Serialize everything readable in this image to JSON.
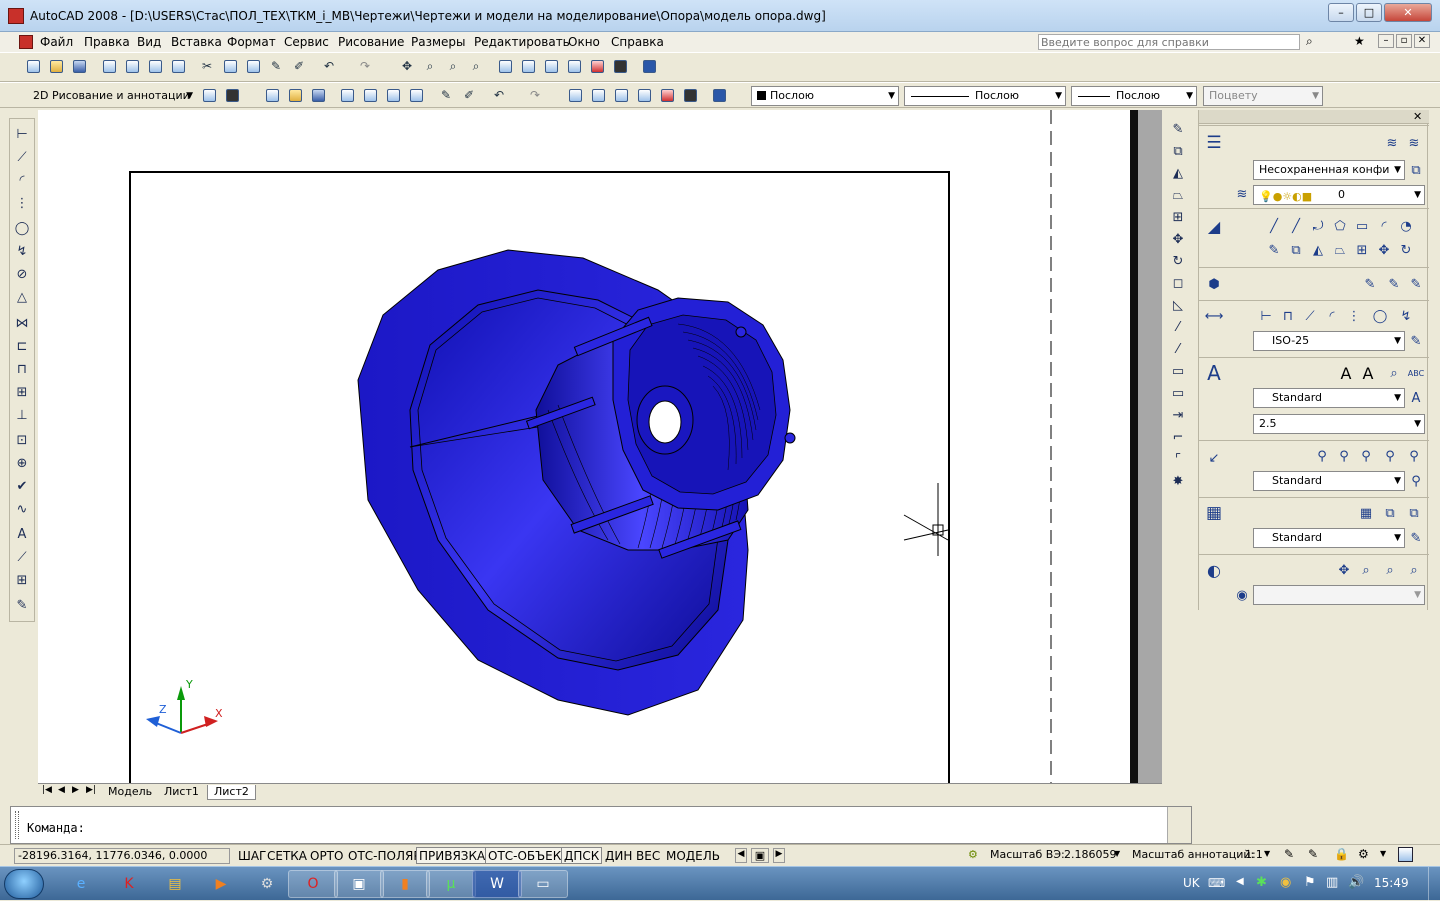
{
  "window": {
    "title": "AutoCAD 2008 - [D:\\USERS\\Стас\\ПОЛ_ТЕХ\\ТКМ_i_МВ\\Чертежи\\Чертежи и модели на моделирование\\Опора\\модель опора.dwg]"
  },
  "menu": [
    "Файл",
    "Правка",
    "Вид",
    "Вставка",
    "Формат",
    "Сервис",
    "Рисование",
    "Размеры",
    "Редактировать",
    "Окно",
    "Справка"
  ],
  "help": {
    "placeholder": "Введите вопрос для справки"
  },
  "toolbar2": {
    "workspace": "2D Рисование и аннотации",
    "color": "Послою",
    "linetype": "Послою",
    "lineweight": "Послою",
    "plotstyle": "Поцвету"
  },
  "panel": {
    "layer_state": "Несохраненная конфи",
    "layer": "0",
    "dimstyle": "ISO-25",
    "textstyle": "Standard",
    "textheight": "2.5",
    "mleaderstyle": "Standard",
    "tablestyle": "Standard"
  },
  "ucs": {
    "x": "X",
    "y": "Y",
    "z": "Z"
  },
  "tabs": [
    "Модель",
    "Лист1",
    "Лист2"
  ],
  "active_tab": "Лист2",
  "command": {
    "prompt": "Команда:"
  },
  "status": {
    "coords": "-28196.3164, 11776.0346, 0.0000",
    "modes": [
      "ШАГ",
      "СЕТКА",
      "ОРТО",
      "ОТС-ПОЛЯР",
      "ПРИВЯЗКА",
      "ОТС-ОБЪЕКТ",
      "ДПСК",
      "ДИН",
      "ВЕС",
      "МОДЕЛЬ"
    ],
    "vp_scale_label": "Масштаб ВЭ:",
    "vp_scale": "2.186059",
    "anno_scale_label": "Масштаб аннотаций:",
    "anno_scale": "1:1"
  },
  "taskbar": {
    "lang": "UK",
    "time": "15:49"
  },
  "colors": {
    "model_blue": "#1a14c8",
    "title_bg": "#c4dbf3",
    "taskbar": "#4f7aa8"
  }
}
